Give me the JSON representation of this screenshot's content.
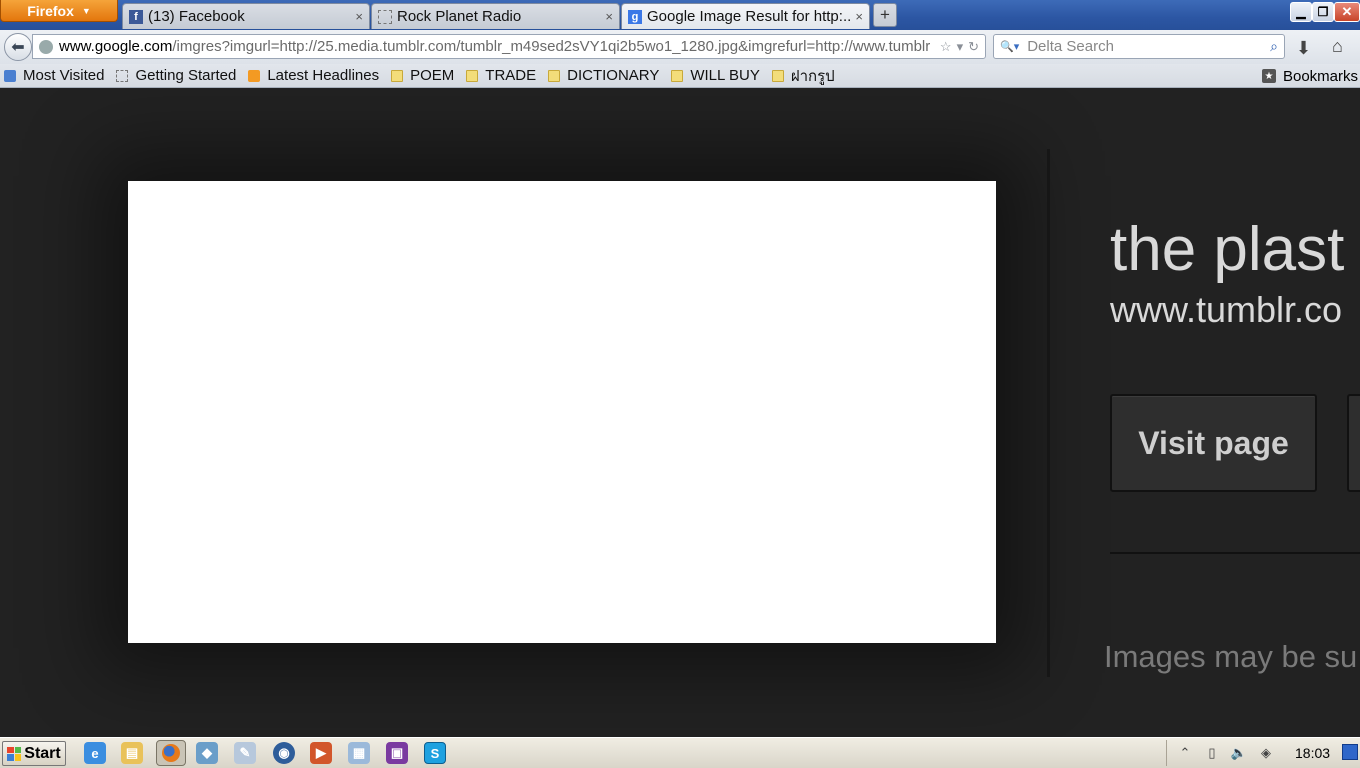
{
  "browser": {
    "menu_label": "Firefox",
    "tabs": [
      {
        "label": "(13) Facebook",
        "icon": "facebook-icon"
      },
      {
        "label": "Rock Planet Radio",
        "icon": "blank-page-icon"
      },
      {
        "label": "Google Image Result for http:...",
        "icon": "google-icon",
        "active": true
      }
    ],
    "tab_close": "×",
    "new_tab": "+"
  },
  "navbar": {
    "url_domain": "www.google.com",
    "url_rest": "/imgres?imgurl=http://25.media.tumblr.com/tumblr_m49sed2sVY1qi2b5wo1_1280.jpg&imgrefurl=http://www.tumblr",
    "search_placeholder": "Delta Search"
  },
  "bookmarks": {
    "items": [
      {
        "label": "Most Visited",
        "icon": "most-visited-icon"
      },
      {
        "label": "Getting Started",
        "icon": "page-icon"
      },
      {
        "label": "Latest Headlines",
        "icon": "rss-icon"
      },
      {
        "label": "POEM",
        "icon": "folder-icon"
      },
      {
        "label": "TRADE",
        "icon": "folder-icon"
      },
      {
        "label": "DICTIONARY",
        "icon": "folder-icon"
      },
      {
        "label": "WILL BUY",
        "icon": "folder-icon"
      },
      {
        "label": "ฝากรูป",
        "icon": "folder-icon"
      }
    ],
    "menu_label": "Bookmarks"
  },
  "page": {
    "title": "the plast",
    "domain": "www.tumblr.co",
    "visit_label": "Visit page",
    "disclaimer": "Images may be su"
  },
  "taskbar": {
    "start_label": "Start",
    "apps": [
      "internet-explorer-icon",
      "file-explorer-icon",
      "firefox-icon",
      "app-icon",
      "paint-icon",
      "media-player-icon",
      "video-icon",
      "calculator-icon",
      "winrar-icon",
      "skype-icon"
    ],
    "clock": "18:03"
  }
}
